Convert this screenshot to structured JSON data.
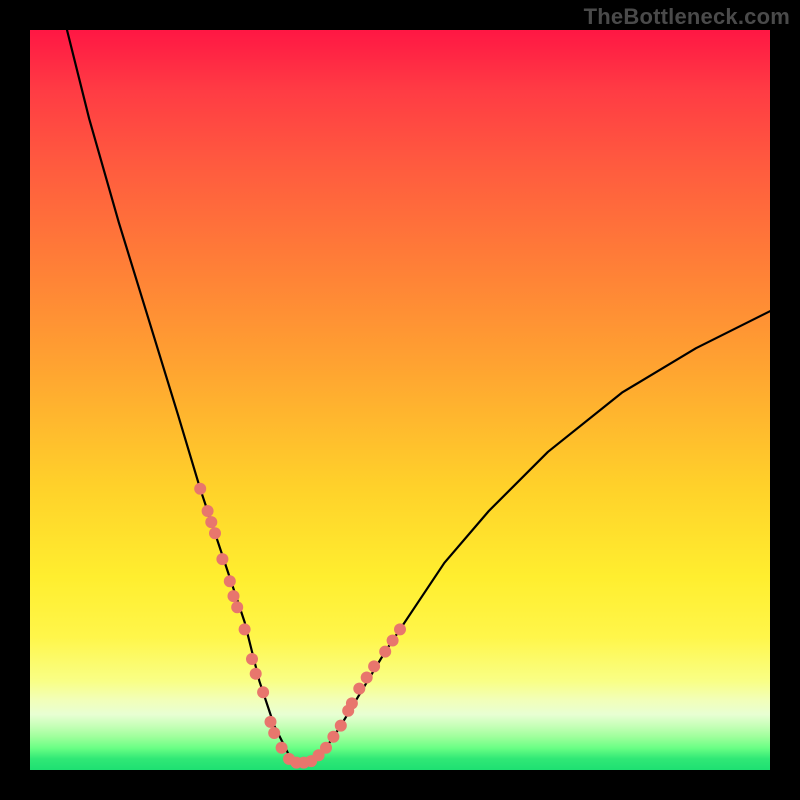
{
  "watermark": "TheBottleneck.com",
  "chart_data": {
    "type": "line",
    "title": "",
    "xlabel": "",
    "ylabel": "",
    "xlim": [
      0,
      100
    ],
    "ylim": [
      0,
      100
    ],
    "grid": false,
    "legend": false,
    "series": [
      {
        "name": "bottleneck-curve",
        "color": "#000000",
        "x": [
          5,
          8,
          12,
          16,
          20,
          23,
          25,
          27,
          29,
          30,
          31,
          32,
          33,
          34,
          35,
          36,
          38,
          40,
          42,
          45,
          48,
          52,
          56,
          62,
          70,
          80,
          90,
          100
        ],
        "y": [
          100,
          88,
          74,
          61,
          48,
          38,
          32,
          26,
          20,
          16,
          12,
          9,
          6,
          4,
          2,
          1,
          1,
          3,
          6,
          11,
          16,
          22,
          28,
          35,
          43,
          51,
          57,
          62
        ]
      }
    ],
    "markers": [
      {
        "name": "curve-dots",
        "color": "#e8766d",
        "radius": 6,
        "points": [
          {
            "x": 23.0,
            "y": 38.0
          },
          {
            "x": 24.0,
            "y": 35.0
          },
          {
            "x": 24.5,
            "y": 33.5
          },
          {
            "x": 25.0,
            "y": 32.0
          },
          {
            "x": 26.0,
            "y": 28.5
          },
          {
            "x": 27.0,
            "y": 25.5
          },
          {
            "x": 27.5,
            "y": 23.5
          },
          {
            "x": 28.0,
            "y": 22.0
          },
          {
            "x": 29.0,
            "y": 19.0
          },
          {
            "x": 30.0,
            "y": 15.0
          },
          {
            "x": 30.5,
            "y": 13.0
          },
          {
            "x": 31.5,
            "y": 10.5
          },
          {
            "x": 32.5,
            "y": 6.5
          },
          {
            "x": 33.0,
            "y": 5.0
          },
          {
            "x": 34.0,
            "y": 3.0
          },
          {
            "x": 35.0,
            "y": 1.5
          },
          {
            "x": 36.0,
            "y": 1.0
          },
          {
            "x": 37.0,
            "y": 1.0
          },
          {
            "x": 38.0,
            "y": 1.2
          },
          {
            "x": 39.0,
            "y": 2.0
          },
          {
            "x": 40.0,
            "y": 3.0
          },
          {
            "x": 41.0,
            "y": 4.5
          },
          {
            "x": 42.0,
            "y": 6.0
          },
          {
            "x": 43.0,
            "y": 8.0
          },
          {
            "x": 43.5,
            "y": 9.0
          },
          {
            "x": 44.5,
            "y": 11.0
          },
          {
            "x": 45.5,
            "y": 12.5
          },
          {
            "x": 46.5,
            "y": 14.0
          },
          {
            "x": 48.0,
            "y": 16.0
          },
          {
            "x": 49.0,
            "y": 17.5
          },
          {
            "x": 50.0,
            "y": 19.0
          }
        ]
      }
    ],
    "annotations": []
  }
}
